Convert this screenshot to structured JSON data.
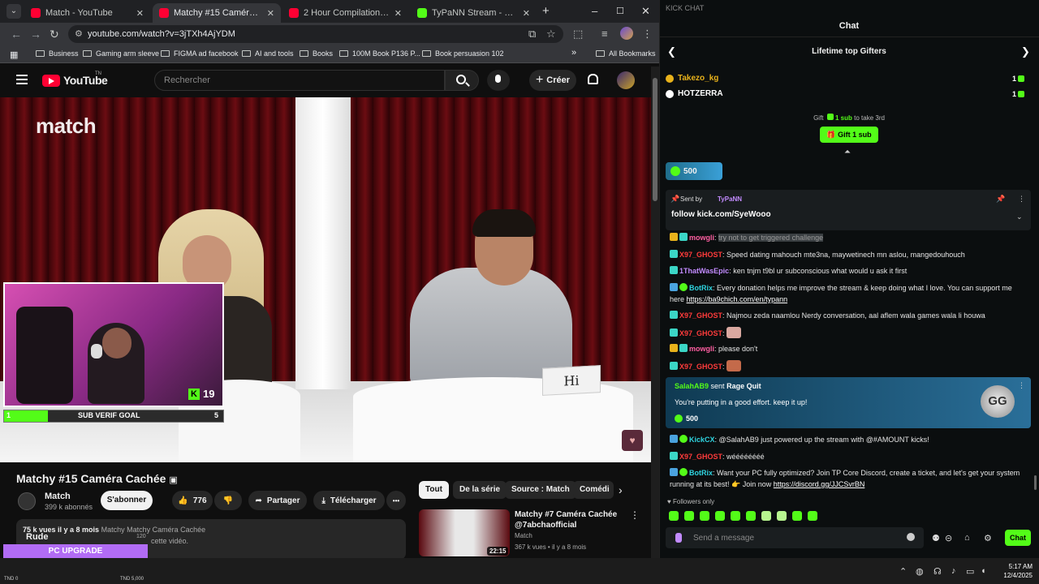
{
  "browser": {
    "tabs": [
      {
        "title": "Match - YouTube",
        "kind": "yt",
        "active": false
      },
      {
        "title": "Matchy #15 Caméra Cachée ...",
        "kind": "yt",
        "active": true
      },
      {
        "title": "2 Hour Compilation Subway Su",
        "kind": "yt",
        "active": false
      },
      {
        "title": "TyPaNN Stream - Watch Live o",
        "kind": "kick",
        "active": false
      }
    ],
    "new_tab": "+",
    "window_controls": {
      "minimize": "–",
      "maximize": "☐",
      "close": "✕"
    },
    "url": "youtube.com/watch?v=3jTXh4AjYDM",
    "bookmarks": [
      "Business",
      "Gaming arm sleeve",
      "FIGMA ad facebook",
      "AI and tools",
      "Books",
      "100M Book P136 P...",
      "Book persuasion 102"
    ],
    "bookmarks_overflow": "»",
    "all_bookmarks": "All Bookmarks"
  },
  "youtube": {
    "logo_text": "YouTube",
    "logo_suffix": "TN",
    "search_placeholder": "Rechercher",
    "create_label": "Créer",
    "video": {
      "watermark": "match",
      "sign_text": "Hi"
    },
    "overlay": {
      "kick_count": "19",
      "goal_current": "1",
      "goal_label": "SUB VERIF GOAL",
      "goal_target": "5"
    },
    "title": "Matchy #15 Caméra Cachée",
    "channel": {
      "name": "Match",
      "subs": "399 k abonnés"
    },
    "subscribe_label": "S'abonner",
    "like_count": "776",
    "share_label": "Partager",
    "download_label": "Télécharger",
    "more_label": "•••",
    "description": {
      "meta": "75 k vues  il y a 8 mois",
      "hashtags": "Matchy Matchy Caméra Cachée",
      "snippet": "cette vidéo."
    },
    "chips": [
      "Tout",
      "De la série",
      "Source : Match",
      "Comédi"
    ],
    "chip_next": "›",
    "related": {
      "title": "Matchy #7 Caméra Cachée @7abchaofficial",
      "channel": "Match",
      "meta": "367 k vues • il y a 8 mois",
      "duration": "22:15"
    }
  },
  "stream_overlay": {
    "rude_label": "Rude",
    "rude_num": "120",
    "upgrade_title": "PC UPGRADE",
    "upgrade_value": "393",
    "upgrade_min": "TND 0",
    "upgrade_max": "TND 5,000",
    "upgrade_fraction": 0.0786
  },
  "taskbar": {
    "time": "5:17 AM",
    "date": "12/4/2025",
    "tray_arrow": "⌃"
  },
  "chat": {
    "window_label": "KICK CHAT",
    "title": "Chat",
    "gifters_title": "Lifetime top Gifters",
    "gifters": [
      {
        "name": "Takezo_kg",
        "count": "1",
        "color": "#e8b21b"
      },
      {
        "name": "HOTZERRA",
        "count": "1",
        "color": "#ffffff"
      }
    ],
    "gift_hint_prefix": "Gift",
    "gift_hint_amount": "1 sub",
    "gift_hint_suffix": "to take 3rd",
    "gift_button": "Gift 1 sub",
    "kicks_amount": "500",
    "pinned": {
      "sent_by": "Sent by",
      "user": "TyPaNN",
      "message": "follow kick.com/SyeWooo"
    },
    "messages": [
      {
        "user": "mowgli",
        "user_color": "#ff5fa2",
        "badges": [
          "crown",
          "sub"
        ],
        "text": "try not to get triggered challenge"
      },
      {
        "user": "X97_GHOST",
        "user_color": "#ff3b3b",
        "badges": [
          "sub"
        ],
        "text": "Speed dating mahouch mte3na, maywetinech mn aslou, mangedouhouch"
      },
      {
        "user": "1ThatWasEpic",
        "user_color": "#c28bff",
        "badges": [
          "sub"
        ],
        "text": "ken tnjm t9bl ur subconscious what would u ask it first"
      },
      {
        "user": "BotRix",
        "user_color": "#2fd4e0",
        "badges": [
          "mod",
          "bot"
        ],
        "text": "Every donation helps me improve the stream & keep doing what I love. You can support me here ",
        "link": "https://ba9chich.com/en/typann"
      },
      {
        "user": "X97_GHOST",
        "user_color": "#ff3b3b",
        "badges": [
          "sub"
        ],
        "text": "Najmou zeda naamlou Nerdy conversation, aal aflem wala games wala li houwa"
      },
      {
        "user": "X97_GHOST",
        "user_color": "#ff3b3b",
        "badges": [
          "sub"
        ],
        "text": "",
        "emote": "#d9a8a0"
      },
      {
        "user": "mowgli",
        "user_color": "#ff5fa2",
        "badges": [
          "crown",
          "sub"
        ],
        "text": "please don't"
      },
      {
        "user": "X97_GHOST",
        "user_color": "#ff3b3b",
        "badges": [
          "sub"
        ],
        "text": "",
        "emote": "#c46a4a"
      }
    ],
    "gift_card": {
      "user": "SalahAB9",
      "action": "sent",
      "item": "Rage Quit",
      "message": "You're putting in a good effort. keep it up!",
      "amount": "500",
      "badge_text": "GG"
    },
    "messages_after": [
      {
        "user": "KickCX",
        "user_color": "#2fd4e0",
        "badges": [
          "mod",
          "bot"
        ],
        "text": "@SalahAB9 just powered up the stream with @#AMOUNT kicks!"
      },
      {
        "user": "X97_GHOST",
        "user_color": "#ff3b3b",
        "badges": [
          "sub"
        ],
        "text": "wéééééééé"
      },
      {
        "user": "BotRix",
        "user_color": "#2fd4e0",
        "badges": [
          "mod",
          "bot"
        ],
        "text": "Want your PC fully optimized? Join TP Core Discord, create a ticket, and let's get your system running at its best! 👉 Join now ",
        "link": "https://discord.gg/JJCSvrBN"
      }
    ],
    "followers_only": "Followers only",
    "input_placeholder": "Send a message",
    "send_label": "Chat"
  },
  "colors": {
    "kick_green": "#53fc18",
    "yt_red": "#ff0033",
    "chat_bg": "#0b0e0f"
  }
}
